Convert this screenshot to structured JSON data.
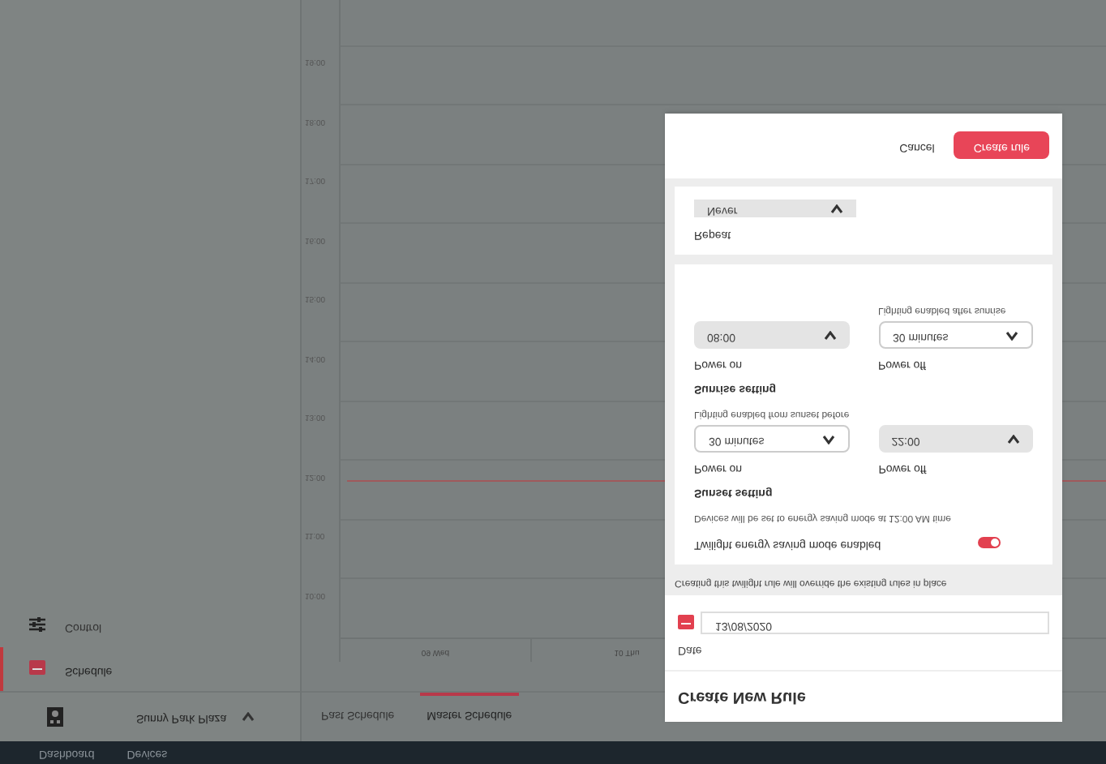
{
  "top_bar": {
    "items": [
      "Dashboard",
      "Devices"
    ]
  },
  "site_selector": {
    "value": "Sunny Park Plaza"
  },
  "tabs": [
    {
      "label": "Past Schedule",
      "selected": false
    },
    {
      "label": "Master Schedule",
      "selected": true
    }
  ],
  "sidebar": {
    "items": [
      {
        "label": "Control",
        "selected": false
      },
      {
        "label": "Schedule",
        "selected": true
      }
    ]
  },
  "calendar": {
    "columns": [
      "09 Wed",
      "10 Thu"
    ],
    "times": [
      "19:00",
      "18:00",
      "17:00",
      "16:00",
      "15:00",
      "14:00",
      "13:00",
      "12:00",
      "11:00",
      "10:00"
    ]
  },
  "dialog": {
    "title": "Create New Rule",
    "date": {
      "label": "Date",
      "value": "13/08/2020"
    },
    "notice": "Creating this twilight rule will override the existing rules in place",
    "twilight": {
      "label": "Twilight energy saving mode enabled",
      "on": true,
      "description": "Devices will be set to energy saving mode at 12:00 AM time"
    },
    "sections": [
      {
        "title": "Sunrise setting",
        "fields": [
          {
            "label": "Power on",
            "kind": "filled",
            "value": "08:00"
          },
          {
            "label": "Power off",
            "kind": "outlined",
            "value": "30 minutes",
            "hint": "Lighting enabled after sunrise"
          }
        ]
      },
      {
        "title": "Sunset setting",
        "fields": [
          {
            "label": "Power on",
            "kind": "outlined",
            "value": "30 minutes",
            "hint": "Lighting enabled from sunset before"
          },
          {
            "label": "Power off",
            "kind": "filled",
            "value": "22:00"
          }
        ]
      }
    ],
    "repeat": {
      "label": "Repeat",
      "value": "Never"
    },
    "buttons": [
      {
        "label": "Cancel",
        "kind": "text"
      },
      {
        "label": "Create rule",
        "kind": "primary"
      }
    ]
  }
}
